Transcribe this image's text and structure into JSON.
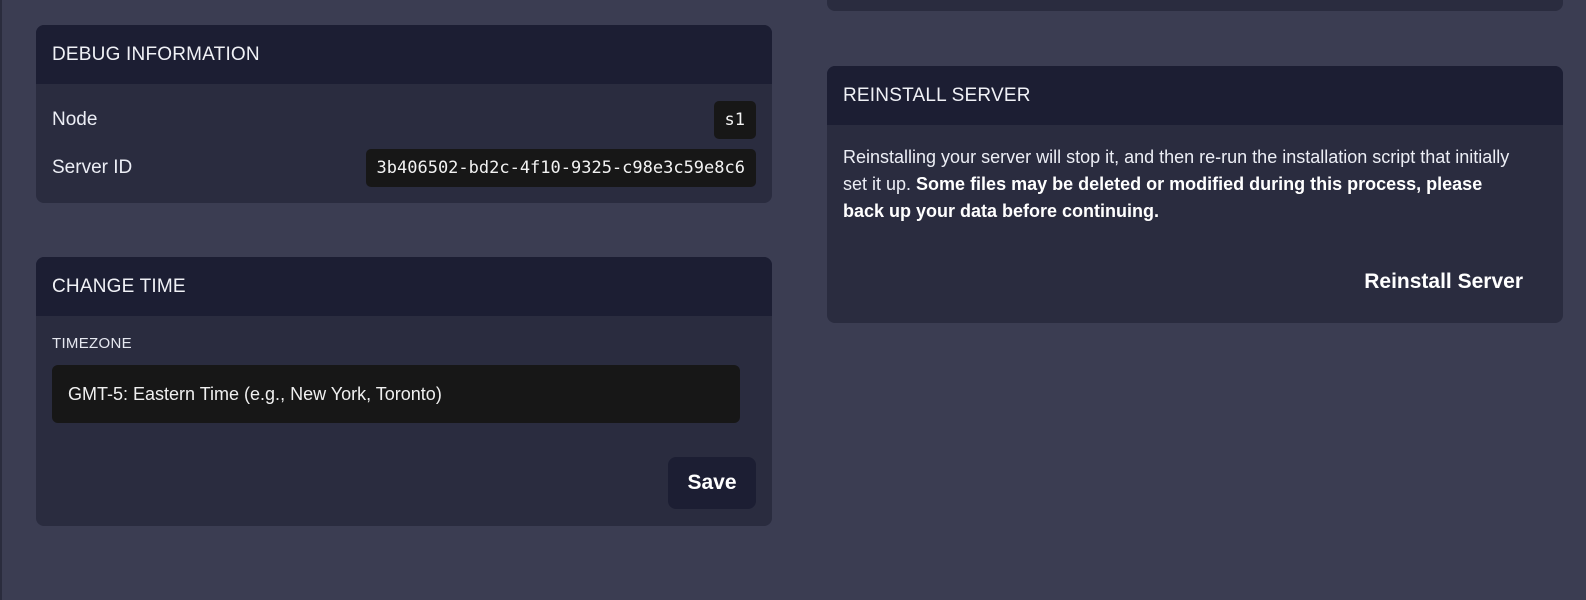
{
  "debug": {
    "title": "DEBUG INFORMATION",
    "rows": [
      {
        "label": "Node",
        "value": "s1"
      },
      {
        "label": "Server ID",
        "value": "3b406502-bd2c-4f10-9325-c98e3c59e8c6"
      }
    ]
  },
  "change_time": {
    "title": "CHANGE TIME",
    "timezone_label": "TIMEZONE",
    "timezone_value": "GMT-5: Eastern Time (e.g., New York, Toronto)",
    "save_label": "Save"
  },
  "reinstall": {
    "title": "REINSTALL SERVER",
    "text_normal": "Reinstalling your server will stop it, and then re-run the installation script that initially set it up. ",
    "text_bold": "Some files may be deleted or modified during this process, please back up your data before continuing.",
    "button_label": "Reinstall Server"
  },
  "colors": {
    "page_bg": "#3b3d52",
    "card_bg": "#2a2c3f",
    "card_header_bg": "#1c1e33",
    "chip_bg": "#171717"
  }
}
